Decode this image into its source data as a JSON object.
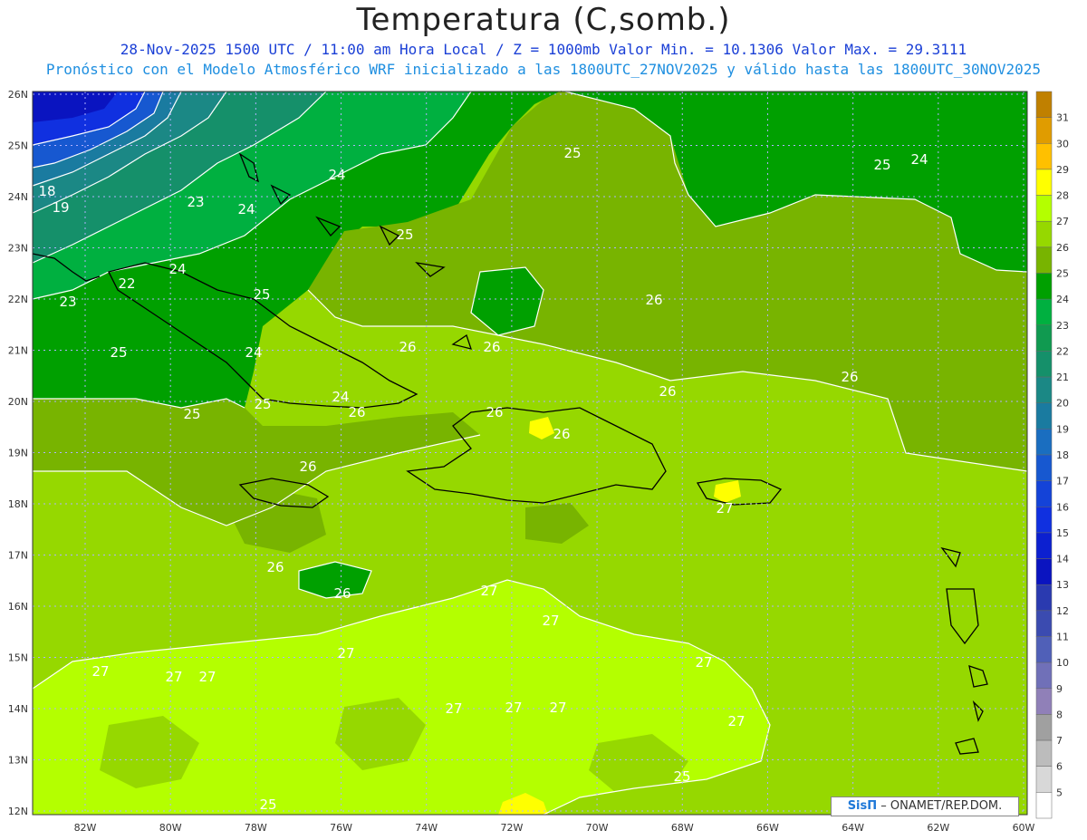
{
  "title": "Temperatura (C,somb.)",
  "subtitle_line1": "28-Nov-2025 1500 UTC / 11:00 am Hora Local / Z = 1000mb  Valor Min. = 10.1306  Valor Max. = 29.3111",
  "subtitle_line2": "Pronóstico con el Modelo Atmosférico WRF inicializado a las 1800UTC_27NOV2025 y válido hasta las  1800UTC_30NOV2025",
  "credit": {
    "brand": "SisΠ",
    "text": "– ONAMET/REP.DOM."
  },
  "map": {
    "lon_labels": [
      "82W",
      "80W",
      "78W",
      "76W",
      "74W",
      "72W",
      "70W",
      "68W",
      "66W",
      "64W",
      "62W",
      "60W"
    ],
    "lat_labels": [
      "26N",
      "25N",
      "24N",
      "23N",
      "22N",
      "21N",
      "20N",
      "19N",
      "18N",
      "17N",
      "16N",
      "15N",
      "14N",
      "13N",
      "12N"
    ],
    "contour_labels": [
      "18",
      "19",
      "23",
      "24",
      "22",
      "23",
      "24",
      "25",
      "24",
      "25",
      "24",
      "25",
      "25",
      "24",
      "25",
      "26",
      "26",
      "26",
      "26",
      "26",
      "26",
      "26",
      "26",
      "26",
      "26",
      "26",
      "27",
      "27",
      "27",
      "27",
      "27",
      "27",
      "27",
      "27",
      "27",
      "27",
      "27",
      "27",
      "25",
      "25",
      "25",
      "25",
      "24"
    ]
  },
  "legend": {
    "levels": [
      "31",
      "30",
      "29",
      "28",
      "27",
      "26",
      "25",
      "24",
      "23",
      "22",
      "21",
      "20",
      "19",
      "18",
      "17",
      "16",
      "15",
      "14",
      "13",
      "12",
      "11",
      "10",
      "9",
      "8",
      "7",
      "6",
      "5"
    ],
    "colors": [
      "#c08000",
      "#e09c00",
      "#ffc000",
      "#ffff00",
      "#b4ff00",
      "#96d800",
      "#78b400",
      "#00a000",
      "#00b040",
      "#109a50",
      "#15906a",
      "#1b8885",
      "#1a7ba0",
      "#1a6ec0",
      "#1758d0",
      "#1443d8",
      "#1030e0",
      "#0c20d0",
      "#0a14c0",
      "#2a3ab0",
      "#3b4bb0",
      "#5060b8",
      "#7070b8",
      "#9080b8",
      "#a0a0a0",
      "#bcbcbc",
      "#d8d8d8",
      "#ffffff"
    ]
  },
  "colors": {
    "blue_title": "#1a3fd6",
    "light_blue": "#1f8fe0",
    "coast": "#000000",
    "contour": "#ffffff"
  }
}
